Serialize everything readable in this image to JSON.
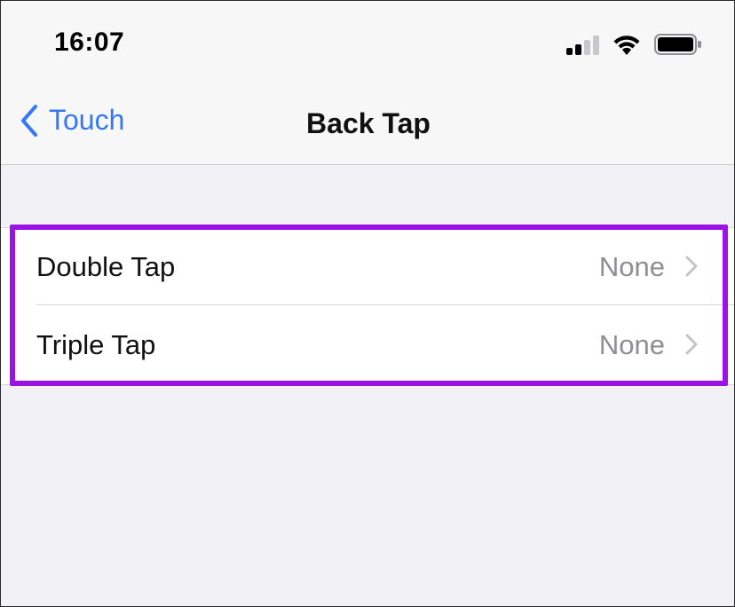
{
  "status_bar": {
    "time": "16:07",
    "icons": [
      "cellular-signal-icon",
      "wifi-icon",
      "battery-icon"
    ]
  },
  "nav": {
    "back_label": "Touch",
    "title": "Back Tap"
  },
  "settings": {
    "rows": [
      {
        "label": "Double Tap",
        "value": "None"
      },
      {
        "label": "Triple Tap",
        "value": "None"
      }
    ]
  },
  "colors": {
    "accent": "#3478f6",
    "highlight": "#9b12e6",
    "secondary_text": "#8e8e93"
  }
}
